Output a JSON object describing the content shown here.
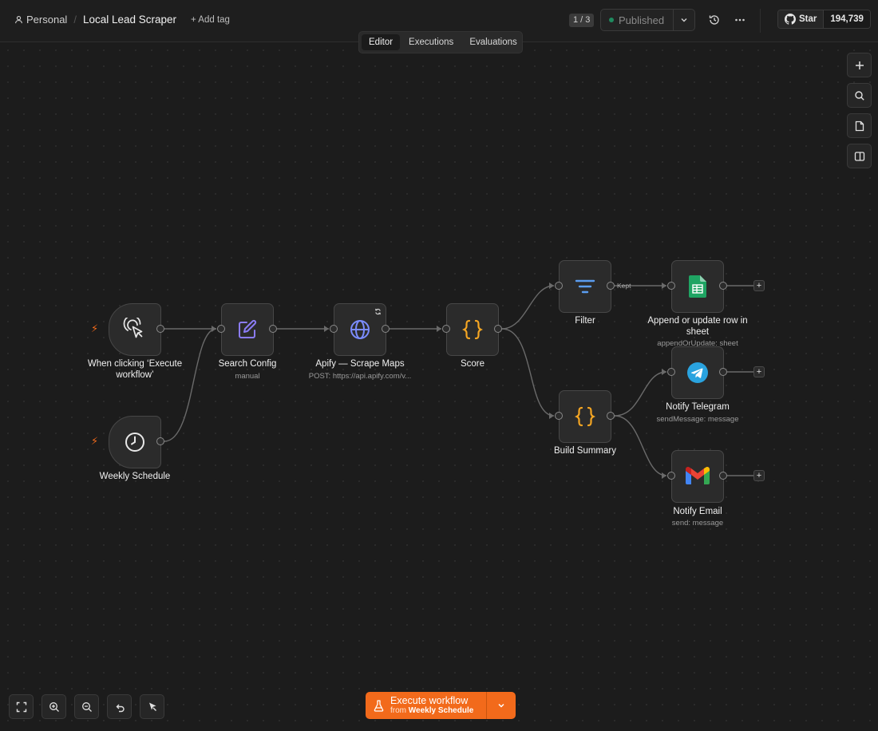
{
  "header": {
    "workspace": "Personal",
    "separator": "/",
    "workflow_title": "Local Lead Scraper",
    "add_tag": "+ Add tag",
    "version": "1 / 3",
    "publish_status": "Published",
    "github_star": "Star",
    "github_count": "194,739"
  },
  "tabs": [
    {
      "label": "Editor",
      "active": true
    },
    {
      "label": "Executions",
      "active": false
    },
    {
      "label": "Evaluations",
      "active": false
    }
  ],
  "nodes": {
    "manual_trigger": {
      "label": "When clicking ‘Execute workflow’",
      "icon": "cursor-click-icon"
    },
    "weekly_schedule": {
      "label": "Weekly Schedule",
      "icon": "clock-icon"
    },
    "search_config": {
      "label": "Search Config",
      "subtitle": "manual",
      "icon": "edit-icon"
    },
    "apify": {
      "label": "Apify — Scrape Maps",
      "subtitle": "POST: https://api.apify.com/v...",
      "icon": "globe-icon"
    },
    "score": {
      "label": "Score",
      "icon": "code-braces-icon"
    },
    "filter": {
      "label": "Filter",
      "icon": "filter-icon"
    },
    "append_sheet": {
      "label": "Append or update row in sheet",
      "subtitle": "appendOrUpdate: sheet",
      "icon": "google-sheets-icon"
    },
    "build_summary": {
      "label": "Build Summary",
      "icon": "code-braces-icon"
    },
    "notify_telegram": {
      "label": "Notify Telegram",
      "subtitle": "sendMessage: message",
      "icon": "telegram-icon"
    },
    "notify_email": {
      "label": "Notify Email",
      "subtitle": "send: message",
      "icon": "gmail-icon"
    }
  },
  "edge_labels": {
    "filter_kept": "Kept"
  },
  "footer": {
    "execute_label": "Execute workflow",
    "execute_from_prefix": "from",
    "execute_from_trigger": "Weekly Schedule"
  },
  "colors": {
    "accent": "#f26a1b",
    "published_dot": "#1f8a5f",
    "code_braces": "#f5a623",
    "edit_icon": "#8b7cf6",
    "globe_icon": "#7b8cff",
    "filter_icon": "#5b9df0"
  }
}
